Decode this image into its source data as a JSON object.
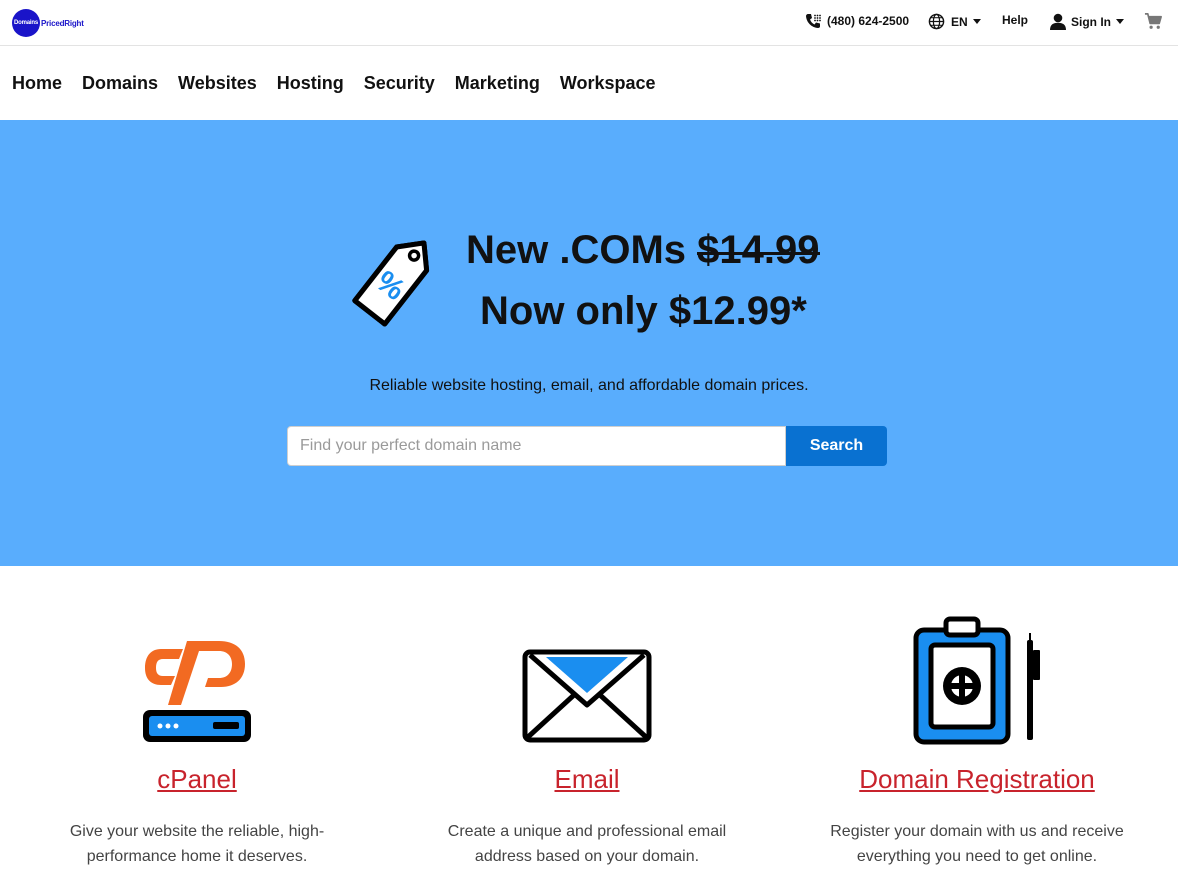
{
  "brand": {
    "logo_circle": "Domains",
    "logo_text": "PricedRight",
    "color": "#1a14c9"
  },
  "utility": {
    "phone": "(480) 624-2500",
    "language": "EN",
    "help": "Help",
    "sign_in": "Sign In"
  },
  "nav": [
    "Home",
    "Domains",
    "Websites",
    "Hosting",
    "Security",
    "Marketing",
    "Workspace"
  ],
  "hero": {
    "line1_prefix": "New .COMs ",
    "old_price": "$14.99",
    "line2": "Now only $12.99*",
    "subtitle": "Reliable website hosting, email, and affordable domain prices.",
    "search_placeholder": "Find your perfect domain name",
    "search_button": "Search",
    "background": "#59adfd",
    "button_color": "#0971d1"
  },
  "features": [
    {
      "title": "cPanel",
      "text": "Give your website the reliable, high-performance home it deserves.",
      "icon": "cpanel-icon"
    },
    {
      "title": "Email",
      "text": "Create a unique and professional email address based on your domain.",
      "icon": "envelope-icon"
    },
    {
      "title": "Domain Registration",
      "text": "Register your domain with us and receive everything you need to get online.",
      "icon": "clipboard-icon"
    }
  ],
  "link_color": "#c8232c"
}
